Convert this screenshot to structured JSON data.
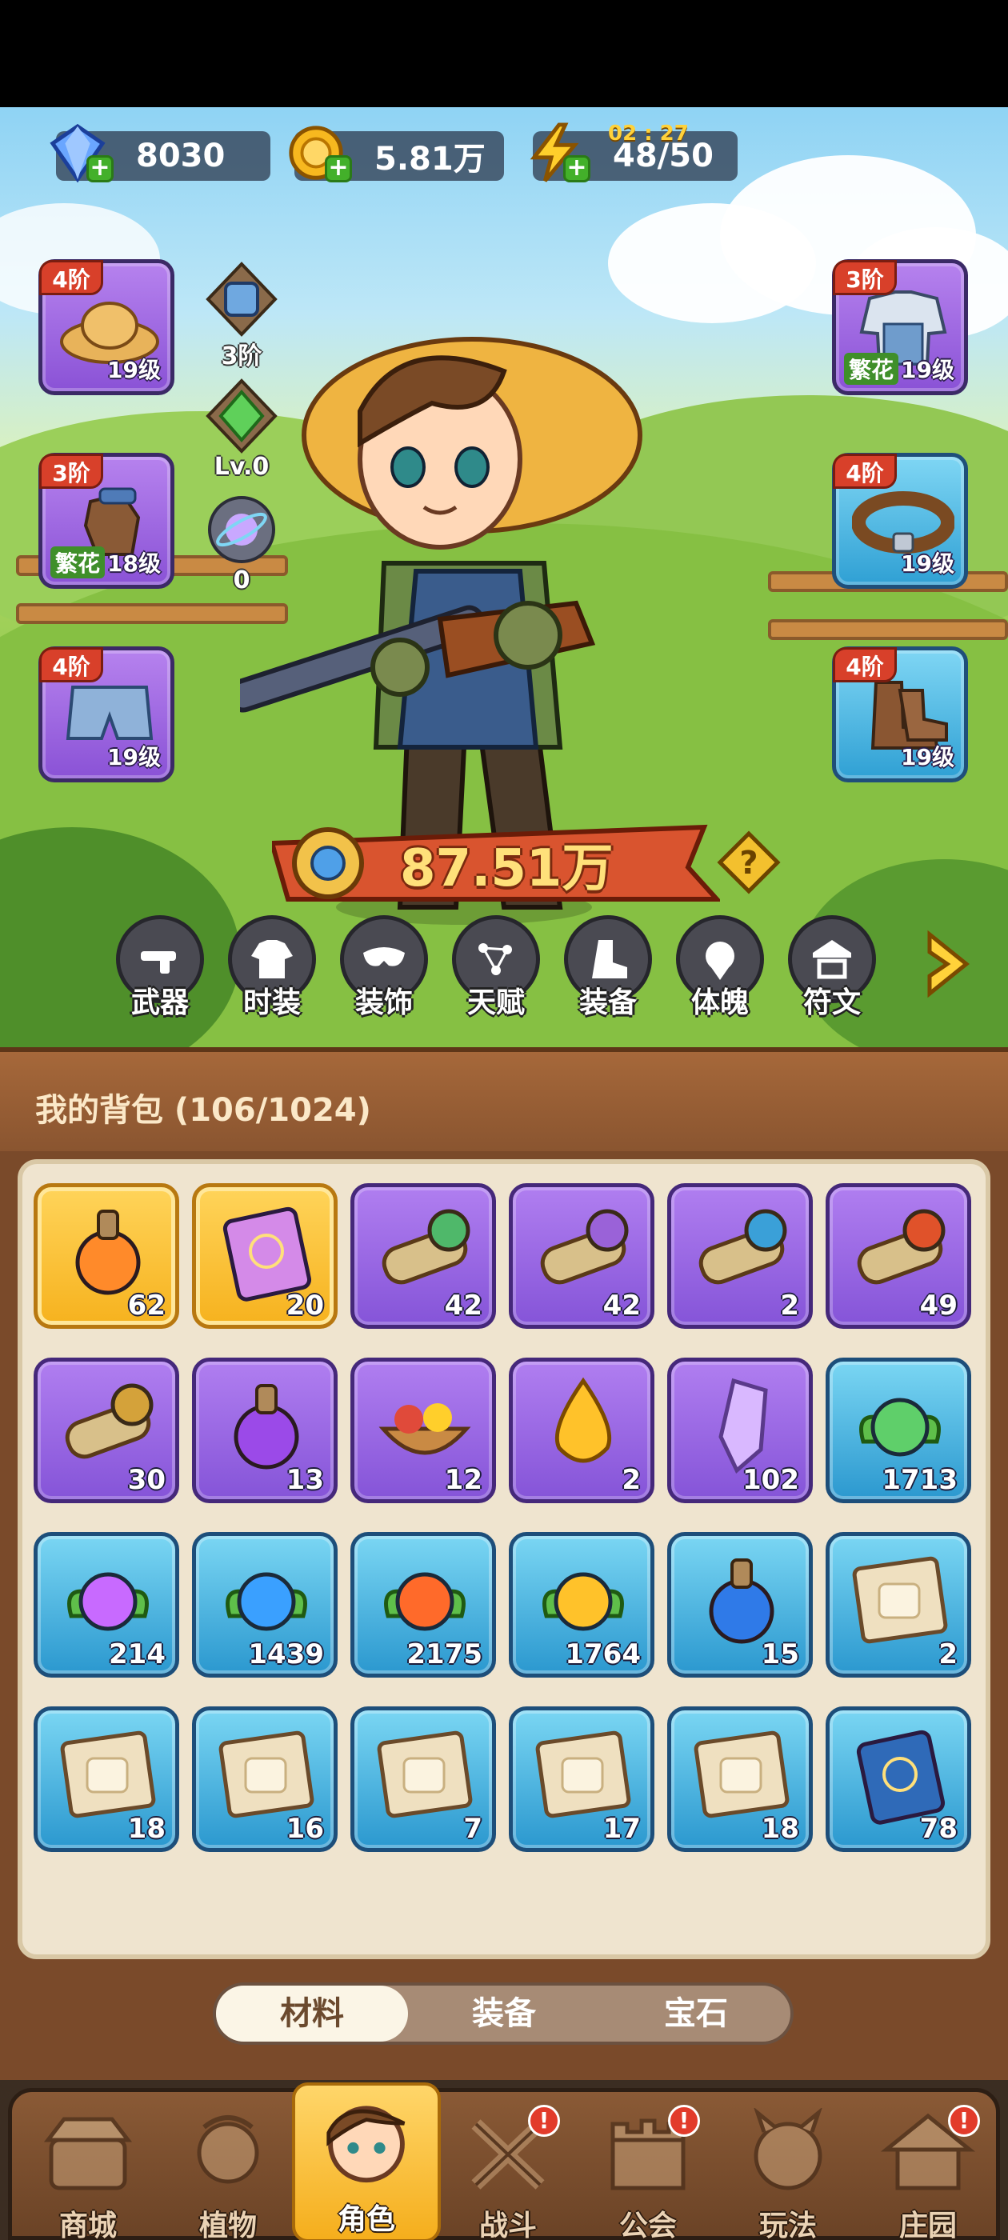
{
  "resources": {
    "gems": {
      "value": "8030"
    },
    "coins": {
      "value": "5.81万"
    },
    "energy": {
      "value": "48/50",
      "timer": "02 : 27"
    }
  },
  "left_slots": [
    {
      "tier": "4阶",
      "level": "19级",
      "icon": "straw-hat-icon"
    },
    {
      "tier": "3阶",
      "level": "18级",
      "tag": "繁花",
      "icon": "leather-glove-icon"
    },
    {
      "tier": "4阶",
      "level": "19级",
      "icon": "shorts-icon"
    }
  ],
  "right_slots": [
    {
      "tier": "3阶",
      "level": "19级",
      "tag": "繁花",
      "icon": "overalls-shirt-icon"
    },
    {
      "tier": "4阶",
      "level": "19级",
      "icon": "belt-icon"
    },
    {
      "tier": "4阶",
      "level": "19级",
      "icon": "boots-icon"
    }
  ],
  "mini_stats": [
    {
      "label": "3阶",
      "icon": "backpack-icon"
    },
    {
      "label": "Lv.0",
      "icon": "green-crystal-icon"
    },
    {
      "label": "0",
      "icon": "orb-icon"
    }
  ],
  "power": {
    "value": "87.51万"
  },
  "feature_tabs": [
    "武器",
    "时装",
    "装饰",
    "天赋",
    "装备",
    "体魄",
    "符文"
  ],
  "bag": {
    "title": "我的背包 (106/1024)",
    "items": [
      {
        "count": "62",
        "rarity": "gold",
        "icon": "orange-potion-icon"
      },
      {
        "count": "20",
        "rarity": "gold",
        "icon": "spell-book-icon"
      },
      {
        "count": "42",
        "rarity": "purple",
        "icon": "green-scroll-icon"
      },
      {
        "count": "42",
        "rarity": "purple",
        "icon": "purple-scroll-icon"
      },
      {
        "count": "2",
        "rarity": "purple",
        "icon": "blue-scroll-icon"
      },
      {
        "count": "49",
        "rarity": "purple",
        "icon": "red-scroll-icon"
      },
      {
        "count": "30",
        "rarity": "purple",
        "icon": "gold-scroll-icon"
      },
      {
        "count": "13",
        "rarity": "purple",
        "icon": "purple-potion-icon"
      },
      {
        "count": "12",
        "rarity": "purple",
        "icon": "fruit-bowl-icon"
      },
      {
        "count": "2",
        "rarity": "purple",
        "icon": "gold-drop-icon"
      },
      {
        "count": "102",
        "rarity": "purple",
        "icon": "crystal-icon"
      },
      {
        "count": "1713",
        "rarity": "blue",
        "icon": "green-seed-icon"
      },
      {
        "count": "214",
        "rarity": "blue",
        "icon": "purple-seed-icon"
      },
      {
        "count": "1439",
        "rarity": "blue",
        "icon": "blue-seed-icon"
      },
      {
        "count": "2175",
        "rarity": "blue",
        "icon": "fire-seed-icon"
      },
      {
        "count": "1764",
        "rarity": "blue",
        "icon": "yellow-seed-icon"
      },
      {
        "count": "15",
        "rarity": "blue",
        "icon": "blue-potion-icon"
      },
      {
        "count": "2",
        "rarity": "blue",
        "icon": "blueprint-hat-icon"
      },
      {
        "count": "18",
        "rarity": "blue",
        "icon": "blueprint-shirt-icon"
      },
      {
        "count": "16",
        "rarity": "blue",
        "icon": "blueprint-glove-icon"
      },
      {
        "count": "7",
        "rarity": "blue",
        "icon": "blueprint-belt-icon"
      },
      {
        "count": "17",
        "rarity": "blue",
        "icon": "blueprint-pants-icon"
      },
      {
        "count": "18",
        "rarity": "blue",
        "icon": "blueprint-boots-icon"
      },
      {
        "count": "78",
        "rarity": "blue",
        "icon": "blue-book-icon"
      }
    ]
  },
  "segment": {
    "tabs": [
      "材料",
      "装备",
      "宝石"
    ],
    "active": 0
  },
  "bottom_nav": [
    {
      "label": "商城",
      "badge": false
    },
    {
      "label": "植物",
      "badge": false
    },
    {
      "label": "角色",
      "badge": false,
      "active": true
    },
    {
      "label": "战斗",
      "badge": true
    },
    {
      "label": "公会",
      "badge": true
    },
    {
      "label": "玩法",
      "badge": false
    },
    {
      "label": "庄园",
      "badge": true
    }
  ],
  "colors": {
    "purple": "#8a52d6",
    "blue": "#2fa0d4",
    "gold": "#f6b21e",
    "tier": "#d8402a",
    "power": "#ffe07a"
  }
}
